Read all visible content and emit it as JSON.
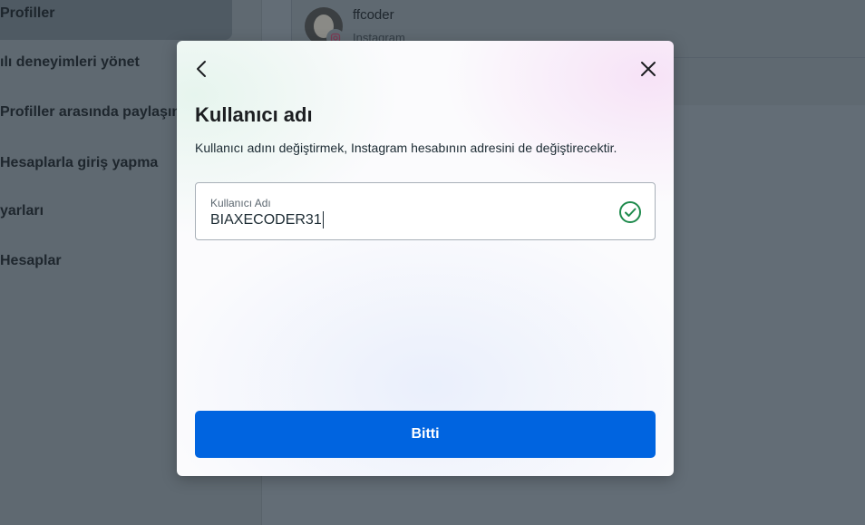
{
  "sidebar": {
    "items": [
      {
        "label": "Profiller"
      },
      {
        "label": "ılı deneyimleri yönet"
      },
      {
        "label": "Profiller arasında paylaşın"
      },
      {
        "label": "Hesaplarla giriş yapma"
      },
      {
        "label": "yarları"
      },
      {
        "label": "Hesaplar"
      }
    ]
  },
  "account_card": {
    "username": "ffcoder",
    "platform": "Instagram",
    "badge_icon": "instagram-icon"
  },
  "modal": {
    "title": "Kullanıcı adı",
    "description": "Kullanıcı adını değiştirmek, Instagram hesabının adresini de değiştirecektir.",
    "field": {
      "label": "Kullanıcı Adı",
      "value": "BIAXECODER31",
      "status_icon": "check-circle-icon"
    },
    "done_label": "Bitti",
    "back_icon": "chevron-left-icon",
    "close_icon": "close-icon"
  },
  "colors": {
    "primary_button": "#0064e0",
    "valid_check": "#1e8a4c",
    "overlay_bg": "#626c75"
  }
}
